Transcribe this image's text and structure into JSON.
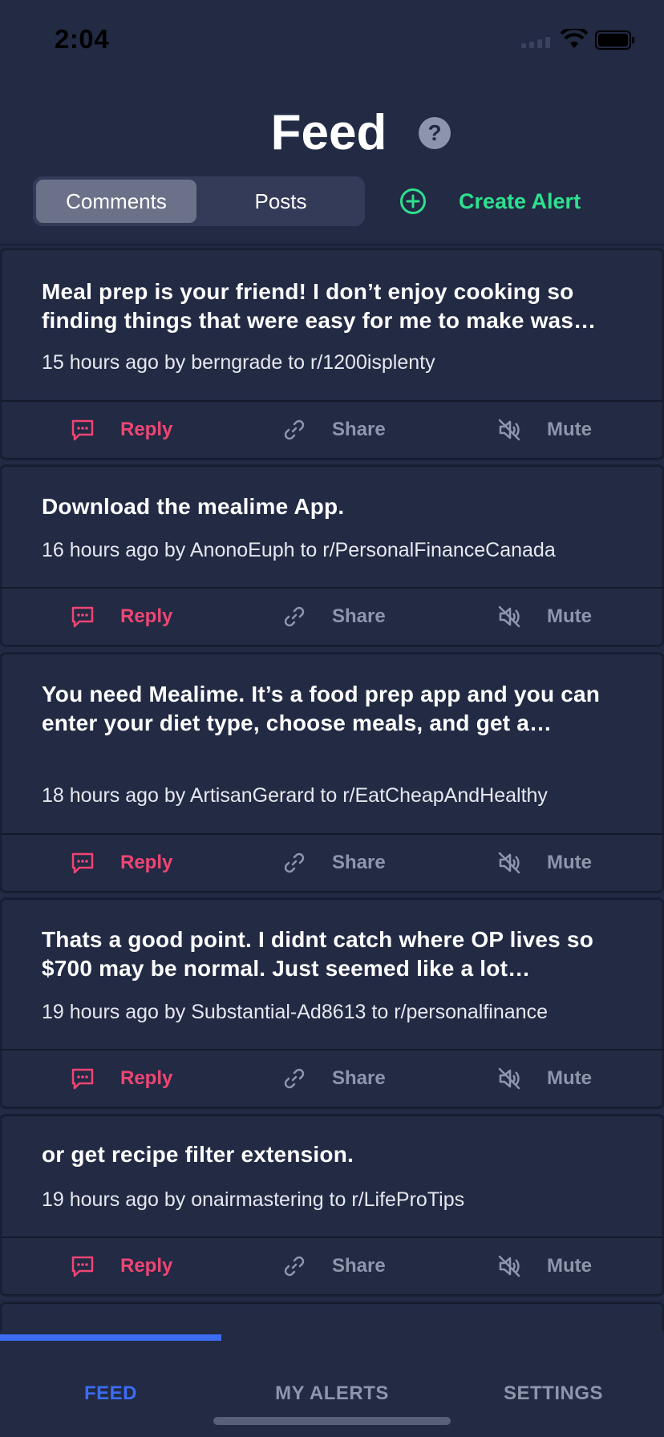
{
  "status_bar": {
    "time": "2:04"
  },
  "header": {
    "title": "Feed",
    "help_icon": "question-circle-icon",
    "segments": [
      "Comments",
      "Posts"
    ],
    "active_segment": "Comments",
    "create_alert_label": "Create Alert"
  },
  "colors": {
    "accent_green": "#2ee08f",
    "reply_pink": "#ef4573",
    "tab_active_blue": "#3b6cf2",
    "background": "#222a44"
  },
  "feed": {
    "items": [
      {
        "text": "Meal prep is your friend! I don’t enjoy cooking so finding things that were easy for me to make was…",
        "meta": "15 hours ago by berngrade to r/1200isplenty",
        "reply": "Reply",
        "share": "Share",
        "mute": "Mute"
      },
      {
        "text": "Download the mealime App.",
        "meta": "16 hours ago by AnonoEuph to r/PersonalFinanceCanada",
        "reply": "Reply",
        "share": "Share",
        "mute": "Mute"
      },
      {
        "text": "You need Mealime. It’s a food prep app and you can enter your diet type, choose meals, and get a…",
        "meta": "18 hours ago by ArtisanGerard to r/EatCheapAndHealthy",
        "reply": "Reply",
        "share": "Share",
        "mute": "Mute"
      },
      {
        "text": "Thats a good point. I didnt catch where OP lives so $700 may be normal. Just seemed like a lot…",
        "meta": "19 hours ago by Substantial-Ad8613 to r/personalfinance",
        "reply": "Reply",
        "share": "Share",
        "mute": "Mute"
      },
      {
        "text": "or get recipe filter extension.",
        "meta": "19 hours ago by onairmastering to r/LifeProTips",
        "reply": "Reply",
        "share": "Share",
        "mute": "Mute"
      }
    ]
  },
  "tabbar": {
    "tabs": [
      "FEED",
      "MY ALERTS",
      "SETTINGS"
    ],
    "active": "FEED"
  }
}
